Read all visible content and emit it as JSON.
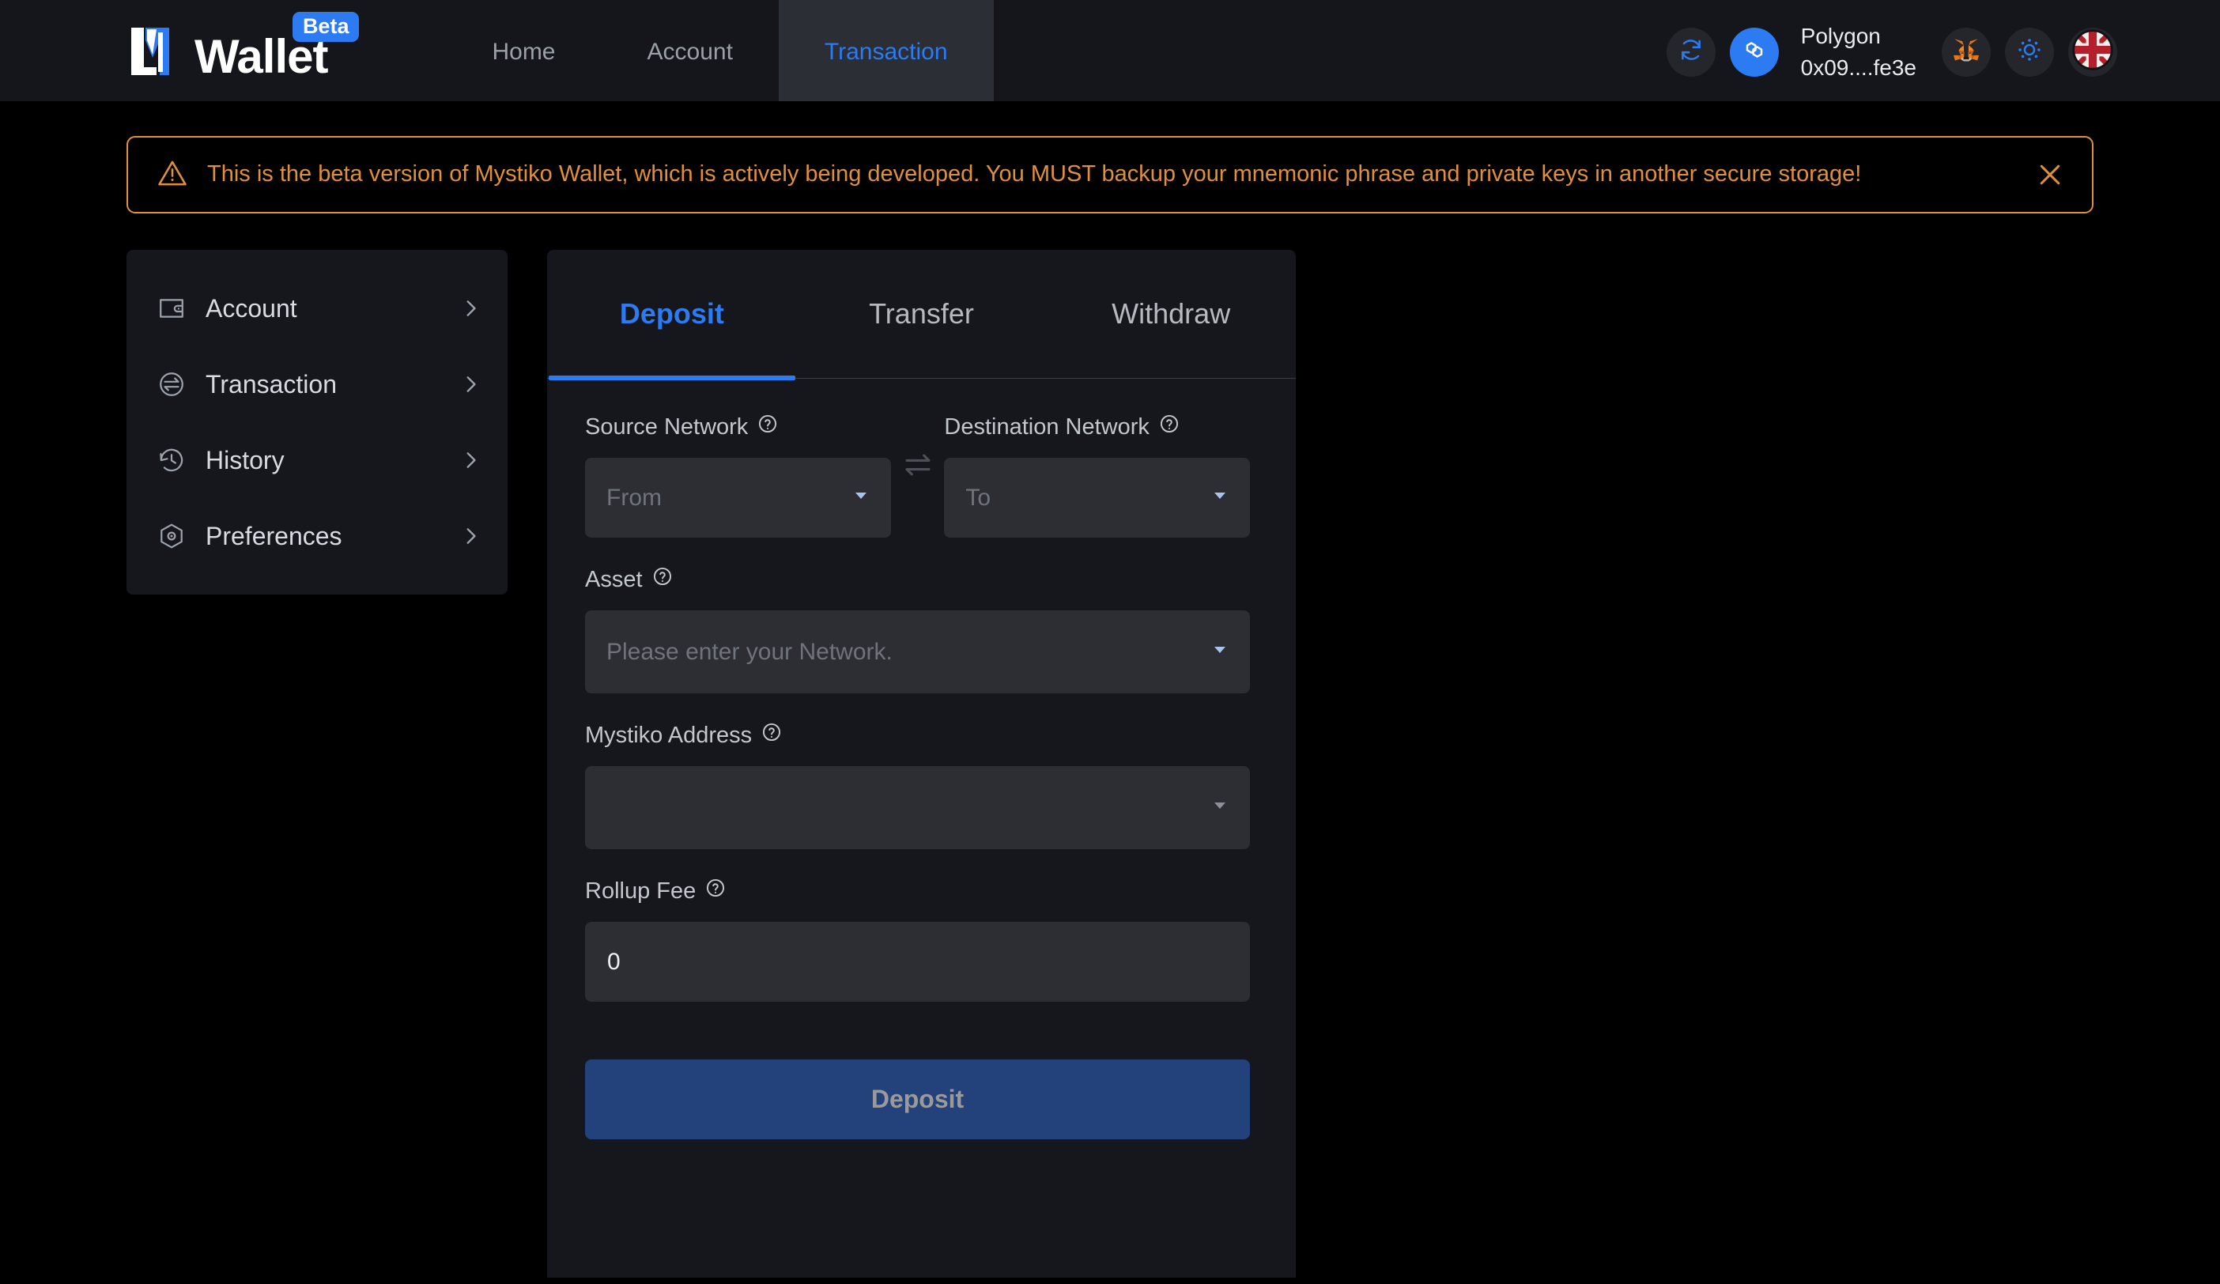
{
  "brand": {
    "word": "Wallet",
    "badge": "Beta",
    "logo_icon": "mystiko-logo-icon"
  },
  "header": {
    "nav": [
      {
        "label": "Home",
        "active": false
      },
      {
        "label": "Account",
        "active": false
      },
      {
        "label": "Transaction",
        "active": true
      }
    ],
    "refresh_icon": "refresh-icon",
    "chain_icon": "polygon-icon",
    "chain_name": "Polygon",
    "wallet_address": "0x09....fe3e",
    "metamask_icon": "metamask-icon",
    "theme_icon": "brightness-icon",
    "language_icon": "uk-flag-icon",
    "accent_color": "#2C7BF2"
  },
  "alert": {
    "icon": "warning-triangle-icon",
    "message": "This is the beta version of Mystiko Wallet, which is actively being developed. You MUST backup your mnemonic phrase and private keys in another secure storage!",
    "close_icon": "close-icon",
    "color": "#E0903C"
  },
  "sidebar": {
    "items": [
      {
        "label": "Account",
        "icon": "wallet-icon"
      },
      {
        "label": "Transaction",
        "icon": "transaction-swap-icon"
      },
      {
        "label": "History",
        "icon": "history-clock-icon"
      },
      {
        "label": "Preferences",
        "icon": "preferences-hexagon-icon"
      }
    ],
    "chevron_icon": "chevron-right-icon"
  },
  "main": {
    "tabs": [
      {
        "label": "Deposit",
        "active": true
      },
      {
        "label": "Transfer",
        "active": false
      },
      {
        "label": "Withdraw",
        "active": false
      }
    ],
    "form": {
      "source_network": {
        "label": "Source Network",
        "help_icon": "help-circle-icon",
        "placeholder": "From",
        "value": "",
        "caret_icon": "chevron-down-icon"
      },
      "swap_icon": "swap-horizontal-icon",
      "destination_network": {
        "label": "Destination Network",
        "help_icon": "help-circle-icon",
        "placeholder": "To",
        "value": "",
        "caret_icon": "chevron-down-icon"
      },
      "asset": {
        "label": "Asset",
        "help_icon": "help-circle-icon",
        "placeholder": "Please enter your Network.",
        "value": "",
        "caret_icon": "chevron-down-icon"
      },
      "mystiko_address": {
        "label": "Mystiko Address",
        "help_icon": "help-circle-icon",
        "placeholder": "",
        "value": "",
        "caret_icon": "chevron-down-icon"
      },
      "rollup_fee": {
        "label": "Rollup Fee",
        "help_icon": "help-circle-icon",
        "value": "0",
        "placeholder": "0"
      },
      "submit_label": "Deposit"
    }
  }
}
